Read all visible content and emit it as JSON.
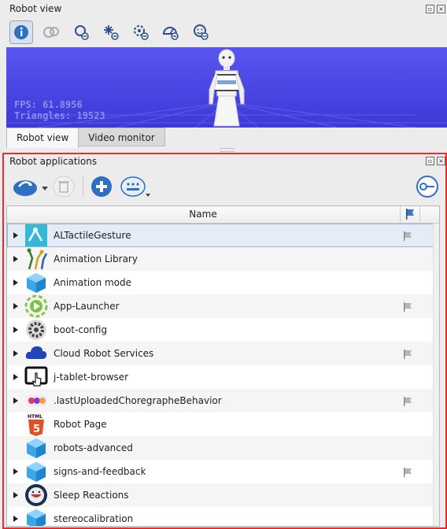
{
  "robot_view": {
    "title": "Robot view",
    "toolbar": [
      {
        "icon": "info-icon",
        "active": true
      },
      {
        "icon": "cogs-icon",
        "active": false
      },
      {
        "icon": "joints-hide-icon",
        "active": false
      },
      {
        "icon": "sensors-hide-icon",
        "active": false
      },
      {
        "icon": "bumpers-hide-icon",
        "active": false
      },
      {
        "icon": "camera-hide-icon",
        "active": false
      },
      {
        "icon": "face-hide-icon",
        "active": false
      }
    ],
    "fps": "FPS: 61.8956",
    "triangles": "Triangles: 19523",
    "tabs": [
      {
        "label": "Robot view",
        "active": true
      },
      {
        "label": "Video monitor",
        "active": false
      }
    ]
  },
  "robot_applications": {
    "title": "Robot applications",
    "column_name": "Name",
    "items": [
      {
        "name": "ALTactileGesture",
        "icon": "tactile-gesture-icon",
        "expandable": true,
        "flag": true,
        "selected": true
      },
      {
        "name": "Animation Library",
        "icon": "animation-library-icon",
        "expandable": true,
        "flag": false
      },
      {
        "name": "Animation mode",
        "icon": "cube-icon",
        "expandable": true,
        "flag": false
      },
      {
        "name": "App-Launcher",
        "icon": "app-launcher-icon",
        "expandable": true,
        "flag": true
      },
      {
        "name": "boot-config",
        "icon": "gear-icon",
        "expandable": true,
        "flag": false
      },
      {
        "name": "Cloud Robot Services",
        "icon": "cloud-icon",
        "expandable": true,
        "flag": true
      },
      {
        "name": "j-tablet-browser",
        "icon": "tablet-touch-icon",
        "expandable": true,
        "flag": false
      },
      {
        "name": ".lastUploadedChoregrapheBehavior",
        "icon": "choregraphe-icon",
        "expandable": true,
        "flag": true
      },
      {
        "name": "Robot Page",
        "icon": "html5-icon",
        "expandable": false,
        "flag": false
      },
      {
        "name": "robots-advanced",
        "icon": "cube-icon",
        "expandable": false,
        "flag": false
      },
      {
        "name": "signs-and-feedback",
        "icon": "cube-icon",
        "expandable": true,
        "flag": true
      },
      {
        "name": "Sleep Reactions",
        "icon": "sleep-reactions-icon",
        "expandable": true,
        "flag": false
      },
      {
        "name": "stereocalibration",
        "icon": "cube-icon",
        "expandable": true,
        "flag": false
      }
    ]
  },
  "colors": {
    "viewport_bg": "#4a45e2",
    "highlight_frame": "#ee2a2a",
    "selection": "#e3ecf7"
  }
}
